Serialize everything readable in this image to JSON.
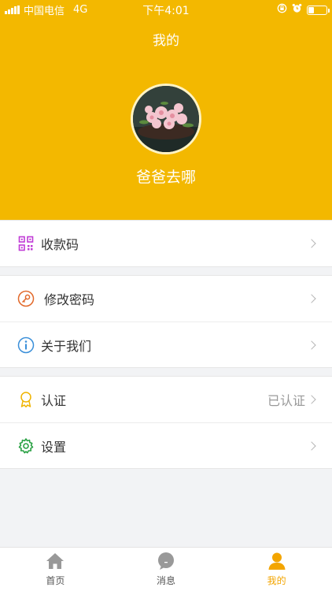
{
  "status": {
    "carrier": "中国电信",
    "network": "4G",
    "time": "下午4:01",
    "battery_level": 0.3
  },
  "header": {
    "title": "我的",
    "nickname": "爸爸去哪",
    "bg_color": "#f3b800"
  },
  "menu": {
    "qr_label": "收款码",
    "password_label": "修改密码",
    "about_label": "关于我们",
    "verify_label": "认证",
    "verify_value": "已认证",
    "settings_label": "设置"
  },
  "tabs": {
    "home_label": "首页",
    "messages_label": "消息",
    "mine_label": "我的",
    "active": "mine",
    "active_color": "#f3a500"
  }
}
